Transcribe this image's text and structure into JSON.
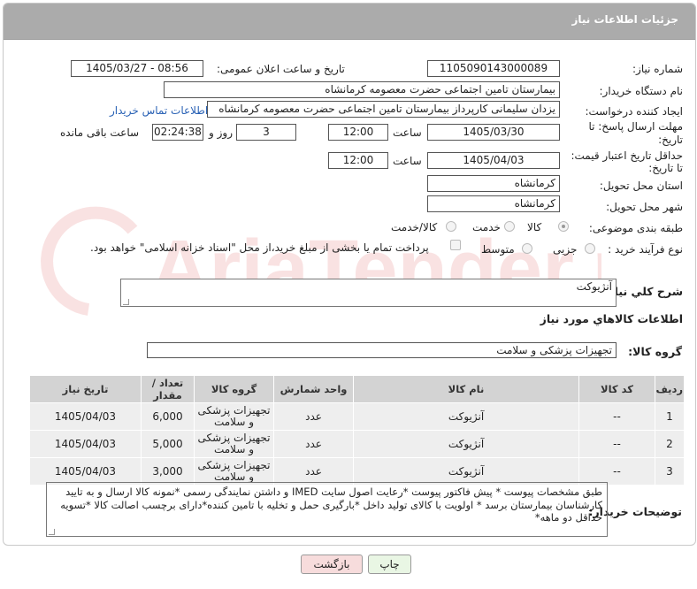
{
  "header": {
    "title": "جزئیات اطلاعات نیاز"
  },
  "form": {
    "need_number_label": "شماره نیاز:",
    "need_number": "1105090143000089",
    "announce_label": "تاریخ و ساعت اعلان عمومی:",
    "announce_value": "1405/03/27 - 08:56",
    "buyer_org_label": "نام دستگاه خریدار:",
    "buyer_org": "بیمارستان تامین اجتماعی حضرت معصومه کرمانشاه",
    "creator_label": "ایجاد کننده درخواست:",
    "creator": "یزدان  سلیمانی کارپرداز بیمارستان تامین اجتماعی حضرت معصومه کرمانشاه",
    "contact_link": "اطلاعات تماس خریدار",
    "deadline_label_1": "مهلت ارسال پاسخ: تا",
    "deadline_label_2": "تاریخ:",
    "deadline_date": "1405/03/30",
    "time_label": "ساعت",
    "deadline_time": "12:00",
    "days_value": "3",
    "days_label": "روز و",
    "remaining_time": "02:24:38",
    "remaining_label": "ساعت باقی مانده",
    "validity_label_1": "حداقل تاریخ اعتبار قیمت:",
    "validity_label_2": "تا تاریخ:",
    "validity_date": "1405/04/03",
    "validity_time": "12:00",
    "province_label": "استان محل تحویل:",
    "province": "کرمانشاه",
    "city_label": "شهر محل تحویل:",
    "city": "کرمانشاه",
    "category_label": "طبقه بندی موضوعی:",
    "category_options": [
      "کالا",
      "خدمت",
      "کالا/خدمت"
    ],
    "process_label": "نوع فرآیند خرید :",
    "process_options": [
      "جزیی",
      "متوسط"
    ],
    "payment_note": "پرداخت تمام یا بخشی از مبلغ خرید،از محل \"اسناد خزانه اسلامی\" خواهد بود."
  },
  "summary": {
    "label": "شرح کلي نياز:",
    "value": "آنژیوکت"
  },
  "goods_section": {
    "title": "اطلاعات کالاهاي مورد نياز",
    "group_label": "گروه کالا:",
    "group_value": "تجهیزات پزشکی و سلامت"
  },
  "table": {
    "headers": [
      "ردیف",
      "کد کالا",
      "نام کالا",
      "واحد شمارش",
      "گروه کالا",
      "تعداد / مقدار",
      "تاریخ نیاز"
    ],
    "rows": [
      {
        "index": "1",
        "code": "--",
        "name": "آنژیوکت",
        "unit": "عدد",
        "group": "تجهیزات پزشکی و سلامت",
        "qty": "6,000",
        "date": "1405/04/03"
      },
      {
        "index": "2",
        "code": "--",
        "name": "آنژیوکت",
        "unit": "عدد",
        "group": "تجهیزات پزشکی و سلامت",
        "qty": "5,000",
        "date": "1405/04/03"
      },
      {
        "index": "3",
        "code": "--",
        "name": "آنژیوکت",
        "unit": "عدد",
        "group": "تجهیزات پزشکی و سلامت",
        "qty": "3,000",
        "date": "1405/04/03"
      }
    ]
  },
  "notes": {
    "label": "توضیحات خریدار:",
    "text": "طبق مشخصات پیوست * پیش فاکتور پیوست *رعایت اصول سایت IMED و داشتن نمایندگی رسمی *نمونه کالا ارسال و به تایید کارشناسان بیمارستان برسد * اولویت با کالای تولید داخل  *بارگیری حمل و تخلیه با تامین کننده*دارای برچسب اصالت کالا *تسویه حداقل دو ماهه*"
  },
  "buttons": {
    "print": "چاپ",
    "back": "بازگشت"
  },
  "watermark": {
    "text": "AriaTender.neT"
  },
  "colors": {
    "header_bg": "#ababab",
    "table_header_bg": "#d3d3d3",
    "table_row_bg": "#eeeeee",
    "print_btn": "#e9f6e4",
    "back_btn": "#f7dcdc",
    "link": "#2a62b5"
  }
}
